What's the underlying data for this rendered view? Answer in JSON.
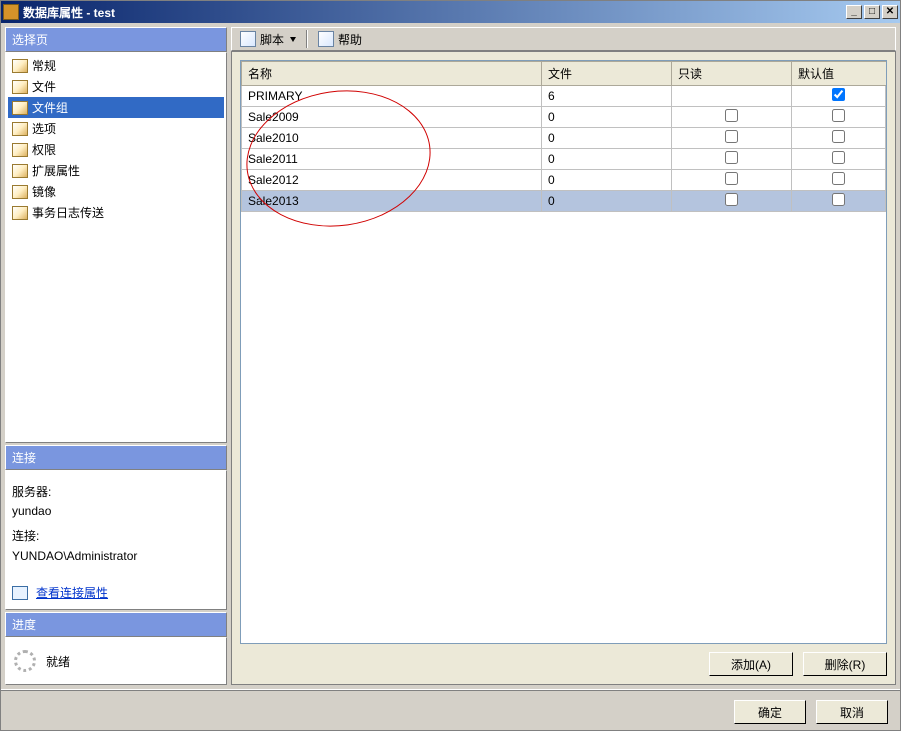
{
  "window": {
    "title": "数据库属性 - test"
  },
  "sidebar": {
    "header": "选择页",
    "items": [
      {
        "label": "常规"
      },
      {
        "label": "文件"
      },
      {
        "label": "文件组"
      },
      {
        "label": "选项"
      },
      {
        "label": "权限"
      },
      {
        "label": "扩展属性"
      },
      {
        "label": "镜像"
      },
      {
        "label": "事务日志传送"
      }
    ],
    "selected_index": 2
  },
  "connection": {
    "header": "连接",
    "server_label": "服务器:",
    "server_value": "yundao",
    "conn_label": "连接:",
    "conn_value": "YUNDAO\\Administrator",
    "view_conn_props": "查看连接属性"
  },
  "progress": {
    "header": "进度",
    "status": "就绪"
  },
  "toolbar": {
    "script_label": "脚本",
    "help_label": "帮助"
  },
  "grid": {
    "columns": {
      "name": "名称",
      "files": "文件",
      "readonly": "只读",
      "default": "默认值"
    },
    "rows": [
      {
        "name": "PRIMARY",
        "files": "6",
        "readonly": null,
        "default": true
      },
      {
        "name": "Sale2009",
        "files": "0",
        "readonly": false,
        "default": false
      },
      {
        "name": "Sale2010",
        "files": "0",
        "readonly": false,
        "default": false
      },
      {
        "name": "Sale2011",
        "files": "0",
        "readonly": false,
        "default": false
      },
      {
        "name": "Sale2012",
        "files": "0",
        "readonly": false,
        "default": false
      },
      {
        "name": "Sale2013",
        "files": "0",
        "readonly": false,
        "default": false
      }
    ],
    "selected_index": 5
  },
  "buttons": {
    "add": "添加(A)",
    "remove": "删除(R)",
    "ok": "确定",
    "cancel": "取消"
  }
}
